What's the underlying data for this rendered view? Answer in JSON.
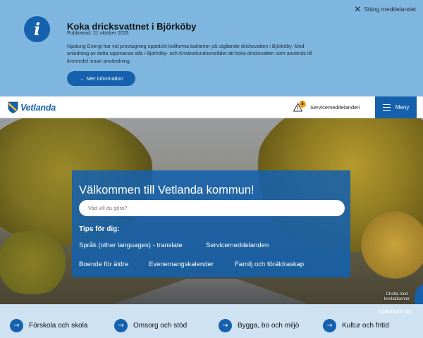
{
  "alert": {
    "icon": "info-icon",
    "close_label": "Stäng meddelandet",
    "title": "Koka dricksvattnet i Björköby",
    "published": "Publicerad: 21 oktober 2025",
    "body": "Njudung Energi har vid provtagning upptäckt koliforma bakterier på utgående dricksvatten i Björköby. Med anledning av detta uppmanas alla i Björköby- och Kristinelundsområdet att koka dricksvatten som används till livsmedel innan användning.",
    "more_button": "Mer information",
    "background": "#7fb6df",
    "accent": "#1561ad"
  },
  "header": {
    "logo_text": "Vetlanda",
    "service_count": "5",
    "service_label": "Servicemeddelanden",
    "menu_label": "Meny"
  },
  "hero": {
    "title": "Välkommen till Vetlanda kommun!",
    "search_placeholder": "Vad vill du göra?",
    "tips_heading": "Tips för dig:",
    "tips": [
      "Språk (other languages) - translate",
      "Servicemeddelanden",
      "Boende för äldre",
      "Evenemangskalender",
      "Familj och föräldraskap"
    ]
  },
  "chat": {
    "label": "Chatta med kontaktcenter"
  },
  "bottom_nav": {
    "contact_label": "CONTACT US",
    "categories": [
      "Förskola och skola",
      "Omsorg och stöd",
      "Bygga, bo och miljö",
      "Kultur och fritid"
    ]
  }
}
